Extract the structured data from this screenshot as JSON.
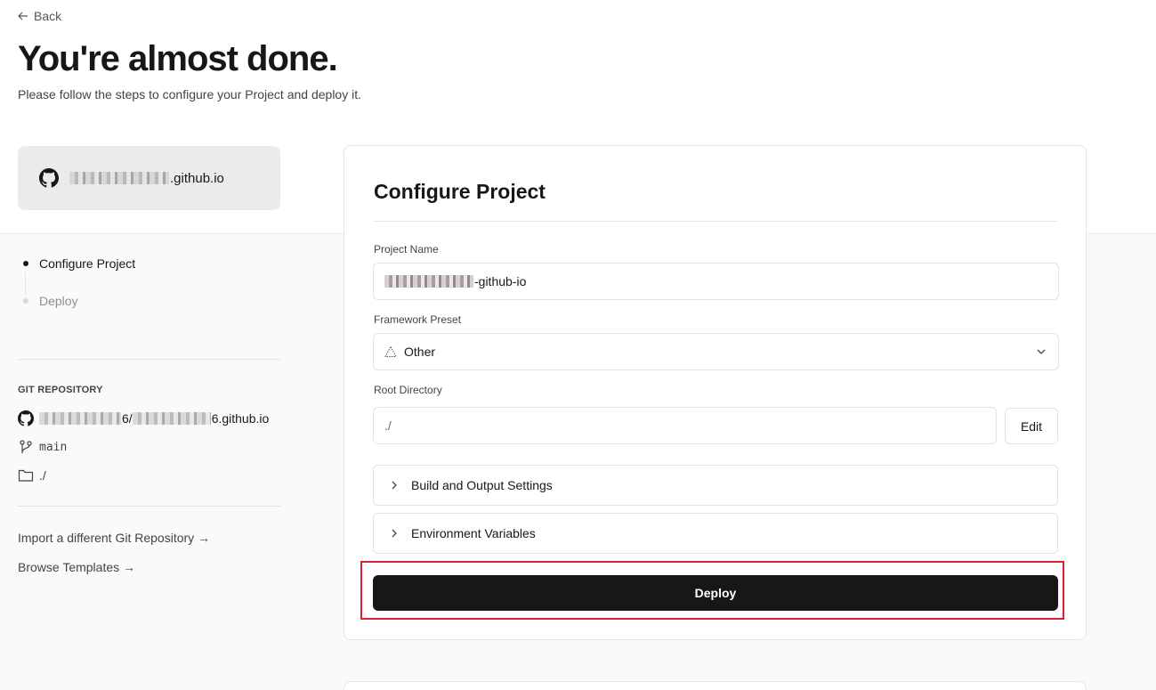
{
  "header": {
    "back_label": "Back",
    "title": "You're almost done.",
    "subtitle": "Please follow the steps to configure your Project and deploy it."
  },
  "repo_card": {
    "name_suffix": ".github.io"
  },
  "steps": [
    {
      "label": "Configure Project",
      "active": true
    },
    {
      "label": "Deploy",
      "active": false
    }
  ],
  "git": {
    "heading": "GIT REPOSITORY",
    "repo_mid": "6/",
    "repo_suffix": "6.github.io",
    "branch": "main",
    "directory": "./"
  },
  "links": {
    "import_repo": "Import a different Git Repository →",
    "browse_templates": "Browse Templates →"
  },
  "config": {
    "title": "Configure Project",
    "project_name_label": "Project Name",
    "project_name_suffix": "-github-io",
    "framework_label": "Framework Preset",
    "framework_value": "Other",
    "root_dir_label": "Root Directory",
    "root_dir_value": "./",
    "edit_label": "Edit",
    "build_settings_label": "Build and Output Settings",
    "env_vars_label": "Environment Variables",
    "deploy_label": "Deploy"
  },
  "icons": {
    "back": "arrow-left-icon",
    "repo": "github-icon",
    "branch": "git-branch-icon",
    "folder": "folder-icon",
    "framework": "triangle-icon",
    "select": "chevron-down-icon",
    "accordion": "chevron-right-icon"
  },
  "colors": {
    "primary": "#171717",
    "highlight": "#d9202e",
    "muted": "#8f8f8f",
    "border": "#e2e2e2"
  }
}
